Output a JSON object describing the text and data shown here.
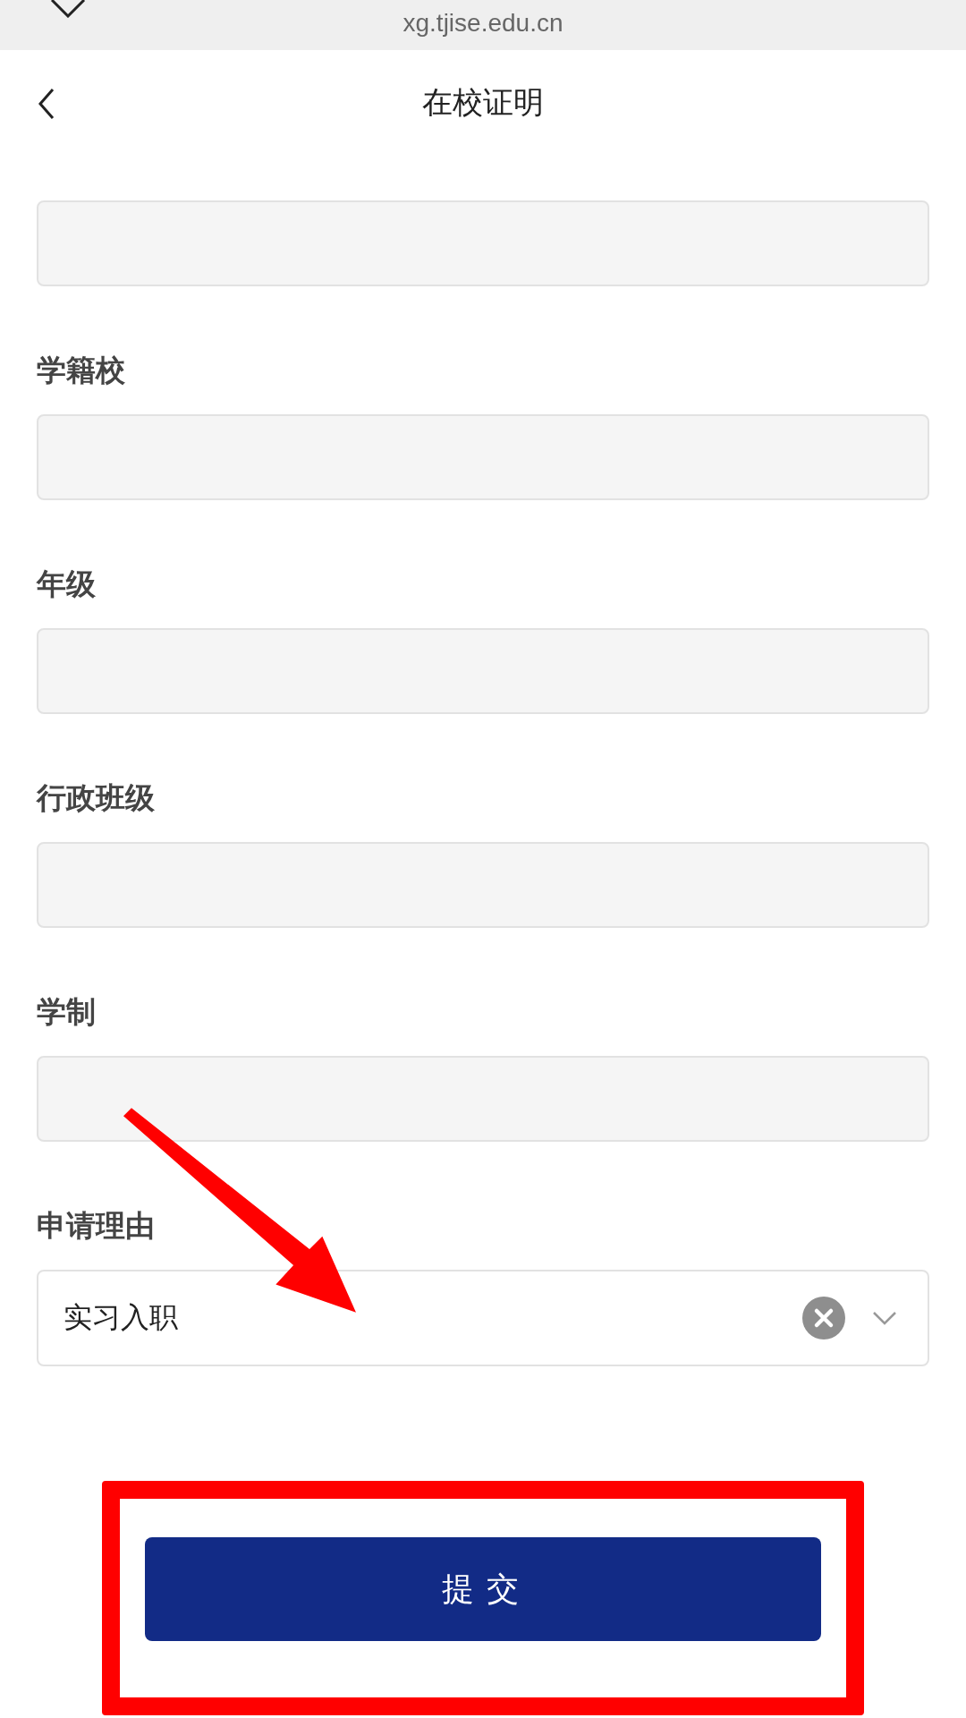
{
  "browser_bar": {
    "url": "xg.tjise.edu.cn"
  },
  "nav_bar": {
    "title": "在校证明"
  },
  "fields": [
    {
      "kind": "text",
      "disabled": true
    },
    {
      "kind": "text",
      "label": "学籍校",
      "disabled": true
    },
    {
      "kind": "text",
      "label": "年级",
      "disabled": true
    },
    {
      "kind": "text",
      "label": "行政班级",
      "disabled": true
    },
    {
      "kind": "text",
      "label": "学制",
      "disabled": true
    },
    {
      "kind": "select",
      "label": "申请理由",
      "value": "实习入职",
      "disabled": false
    }
  ],
  "submit_button": {
    "label": "提交"
  },
  "annotations": {
    "arrow": true,
    "highlight_frame": true
  }
}
